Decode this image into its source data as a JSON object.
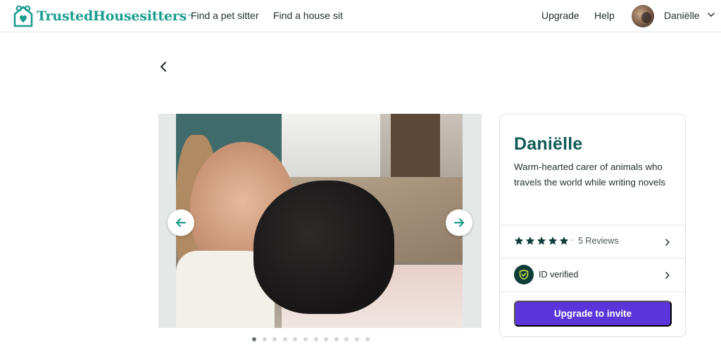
{
  "header": {
    "logo_text": "TrustedHousesitters",
    "logo_tm": "™",
    "nav": {
      "find_pet_sitter": "Find a pet sitter",
      "find_house_sit": "Find a house sit",
      "upgrade": "Upgrade",
      "help": "Help"
    },
    "user_name": "Daniëlle"
  },
  "carousel": {
    "dot_count": 12,
    "active_index": 0
  },
  "profile": {
    "name": "Daniëlle",
    "bio": "Warm-hearted carer of animals who travels the world while writing novels",
    "rating_stars": 5,
    "separator": "·",
    "reviews_label": "5 Reviews",
    "verified_label": "ID verified",
    "invite_button": "Upgrade to invite"
  },
  "colors": {
    "brand_teal": "#1a9c8f",
    "name_teal": "#0f5a55",
    "button_purple": "#5b35d9",
    "shield_dark": "#0f3d38",
    "star_dark": "#0f3d38"
  },
  "icons": [
    "house-logo-icon",
    "chevron-down-icon",
    "back-chevron-icon",
    "arrow-left-icon",
    "arrow-right-icon",
    "star-icon",
    "chevron-right-icon",
    "shield-check-icon"
  ]
}
